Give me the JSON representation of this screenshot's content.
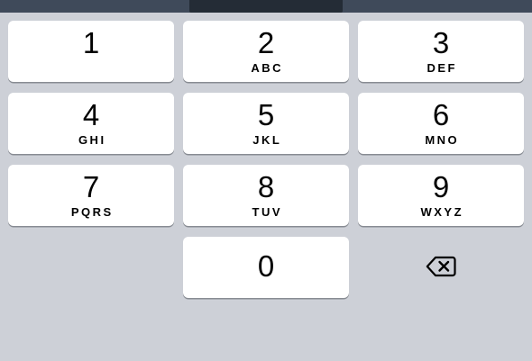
{
  "keys": [
    {
      "digit": "1",
      "letters": ""
    },
    {
      "digit": "2",
      "letters": "ABC"
    },
    {
      "digit": "3",
      "letters": "DEF"
    },
    {
      "digit": "4",
      "letters": "GHI"
    },
    {
      "digit": "5",
      "letters": "JKL"
    },
    {
      "digit": "6",
      "letters": "MNO"
    },
    {
      "digit": "7",
      "letters": "PQRS"
    },
    {
      "digit": "8",
      "letters": "TUV"
    },
    {
      "digit": "9",
      "letters": "WXYZ"
    },
    {
      "digit": "0",
      "letters": ""
    }
  ],
  "delete_key": {
    "icon": "backspace-icon"
  },
  "colors": {
    "background": "#cdd0d7",
    "key": "#ffffff",
    "key_shadow": "#888c93",
    "top_bar": "#3f4a5a"
  }
}
